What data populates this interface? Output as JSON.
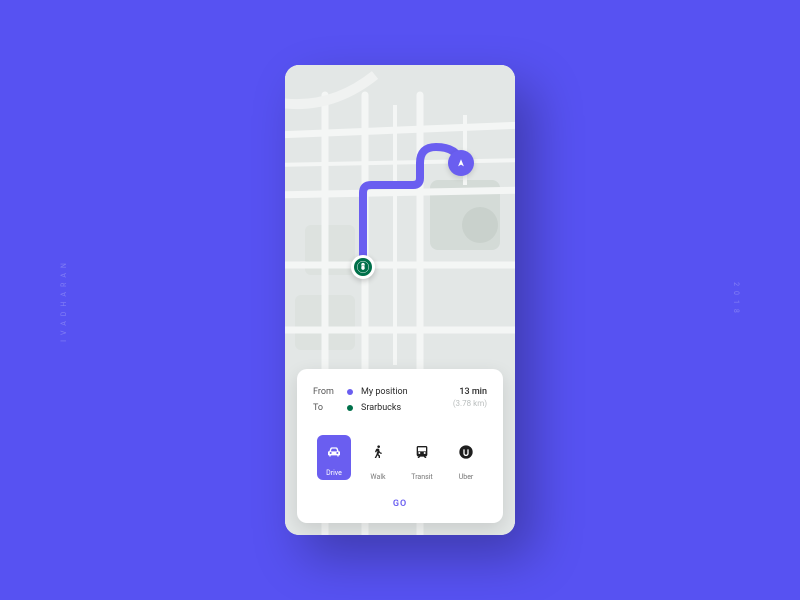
{
  "side": {
    "left": "IVADHARAN",
    "right": "2018"
  },
  "route": {
    "from_label": "From",
    "to_label": "To",
    "from_value": "My position",
    "to_value": "Srarbucks",
    "time": "13 min",
    "distance": "(3.78 km)"
  },
  "modes": {
    "items": [
      {
        "label": "Drive",
        "active": true
      },
      {
        "label": "Walk",
        "active": false
      },
      {
        "label": "Transit",
        "active": false
      },
      {
        "label": "Uber",
        "active": false
      }
    ]
  },
  "go_label": "GO",
  "colors": {
    "accent": "#6a5ef0",
    "brand_green": "#00704a"
  }
}
